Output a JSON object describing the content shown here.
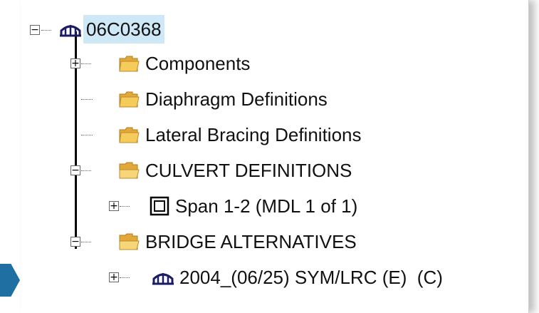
{
  "tree": {
    "root": {
      "label": "06C0368",
      "icon": "bridge-icon",
      "expander": "−"
    },
    "items": [
      {
        "label": "Components",
        "icon": "folder-icon",
        "expander": "+"
      },
      {
        "label": "Diaphragm Definitions",
        "icon": "folder-icon",
        "expander": ""
      },
      {
        "label": "Lateral Bracing Definitions",
        "icon": "folder-icon",
        "expander": ""
      },
      {
        "label": "CULVERT DEFINITIONS",
        "icon": "folder-open-icon",
        "expander": "−"
      },
      {
        "label": "Span 1-2 (MDL 1 of 1)",
        "icon": "culvert-span-icon",
        "expander": "+"
      },
      {
        "label": "BRIDGE ALTERNATIVES",
        "icon": "folder-open-icon",
        "expander": "−"
      },
      {
        "label": "2004_(06/25) SYM/LRC (E)  (C)",
        "icon": "bridge-icon",
        "expander": "+"
      }
    ]
  },
  "colors": {
    "selection": "#cfe8f7",
    "folder": "#f2c24b",
    "accent": "#1f6fa3"
  }
}
